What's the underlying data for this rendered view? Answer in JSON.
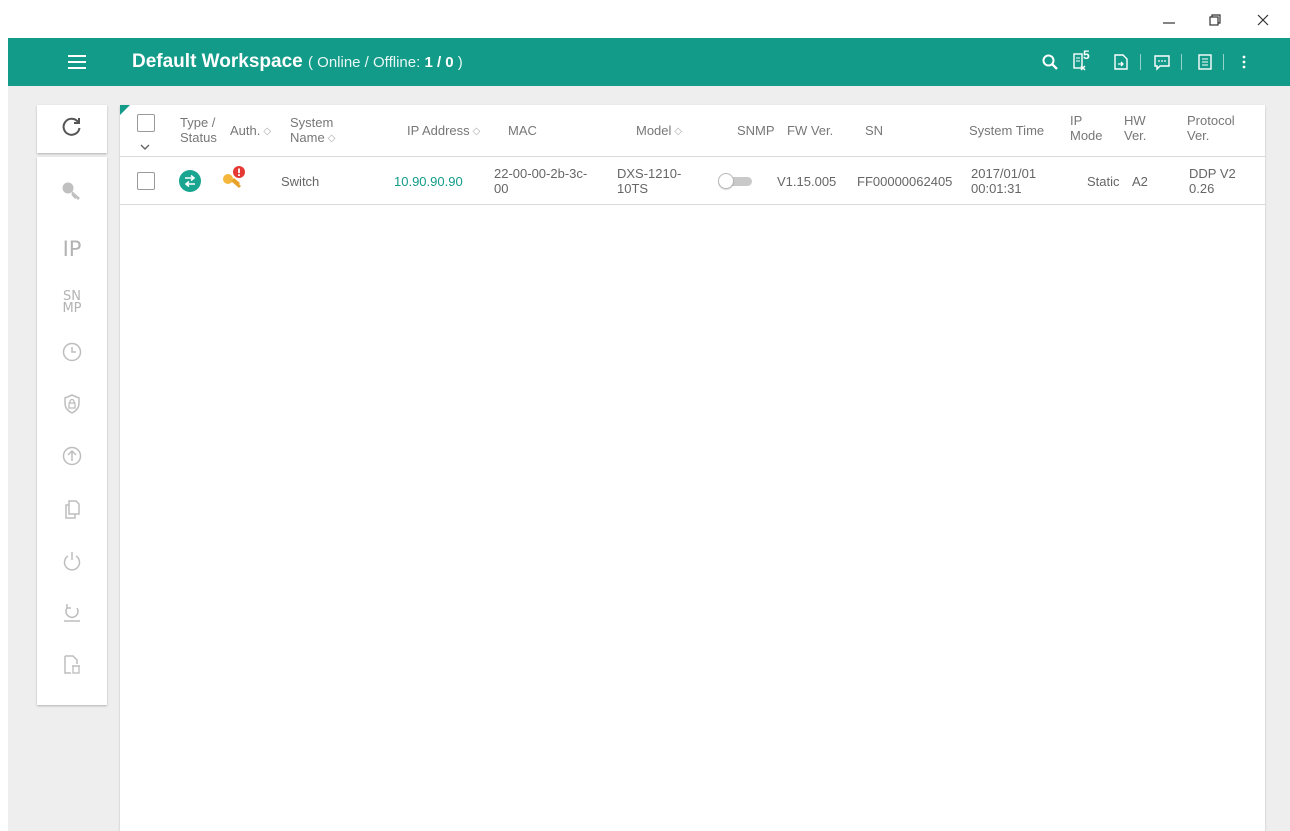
{
  "window": {
    "minimize_icon": "minimize-icon",
    "restore_icon": "restore-icon",
    "close_icon": "close-icon"
  },
  "header": {
    "menu_icon": "hamburger-menu-icon",
    "title": "Default Workspace",
    "status_open": "( Online / Offline: ",
    "status_counts": "1 / 0",
    "status_close": ")",
    "badge": "5",
    "icons": [
      "search-icon",
      "error-log-icon",
      "export-icon",
      "message-icon",
      "log-icon",
      "more-vert-icon"
    ],
    "bg_color": "#129b89"
  },
  "toolbar": {
    "refresh_icon": "refresh-icon",
    "tools": [
      {
        "name": "key",
        "label": ""
      },
      {
        "name": "ip",
        "label": "IP"
      },
      {
        "name": "snmp",
        "label_top": "SN",
        "label_bottom": "MP"
      },
      {
        "name": "clock",
        "label": ""
      },
      {
        "name": "security",
        "label": ""
      },
      {
        "name": "upload",
        "label": ""
      },
      {
        "name": "copy",
        "label": ""
      },
      {
        "name": "power",
        "label": ""
      },
      {
        "name": "reset",
        "label": ""
      },
      {
        "name": "delete-file",
        "label": ""
      }
    ]
  },
  "table": {
    "columns": {
      "type_status_1": "Type /",
      "type_status_2": "Status",
      "auth": "Auth.",
      "system_name_1": "System",
      "system_name_2": "Name",
      "ip_address": "IP Address",
      "mac": "MAC",
      "model": "Model",
      "snmp": "SNMP",
      "fw_ver": "FW Ver.",
      "sn": "SN",
      "system_time": "System Time",
      "ip_mode_1": "IP",
      "ip_mode_2": "Mode",
      "hw_ver_1": "HW",
      "hw_ver_2": "Ver.",
      "protocol_ver_1": "Protocol",
      "protocol_ver_2": "Ver."
    },
    "rows": [
      {
        "type_icon": "switch-device-icon",
        "auth_icon": "key-warning-icon",
        "system_name": "Switch",
        "ip_address": "10.90.90.90",
        "mac_1": "22-00-00-2b-3c-",
        "mac_2": "00",
        "model_1": "DXS-1210-",
        "model_2": "10TS",
        "snmp_enabled": false,
        "fw_ver": "V1.15.005",
        "sn": "FF00000062405",
        "system_time_1": "2017/01/01",
        "system_time_2": "00:01:31",
        "ip_mode": "Static",
        "hw_ver": "A2",
        "protocol_ver_1": "DDP V2",
        "protocol_ver_2": "0.26"
      }
    ]
  }
}
